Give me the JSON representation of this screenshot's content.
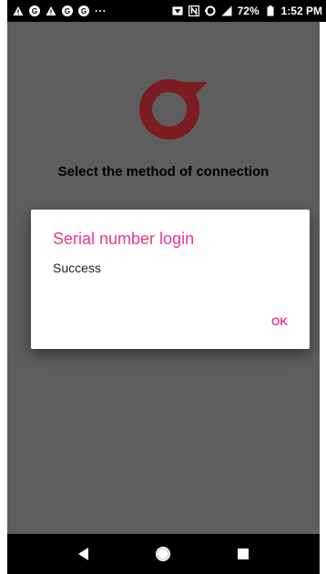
{
  "status_bar": {
    "left_icons": [
      "warning-icon",
      "notification-icon",
      "warning-icon",
      "notification-icon",
      "notification-icon",
      "more-notifications-icon"
    ],
    "right_icons": [
      "cast-icon",
      "nfc-icon",
      "data-saver-icon",
      "signal-icon"
    ],
    "battery_percent": "72%",
    "time": "1:52 PM"
  },
  "screen": {
    "title": "Select the method of connection",
    "logo_color": "#7b1c22",
    "overlay_color": "#5e5e5e"
  },
  "dialog": {
    "title": "Serial number login",
    "message": "Success",
    "ok_label": "OK",
    "accent_color": "#ec3a8b"
  },
  "nav_bar": {
    "items": [
      "back-icon",
      "home-icon",
      "recents-icon"
    ]
  }
}
